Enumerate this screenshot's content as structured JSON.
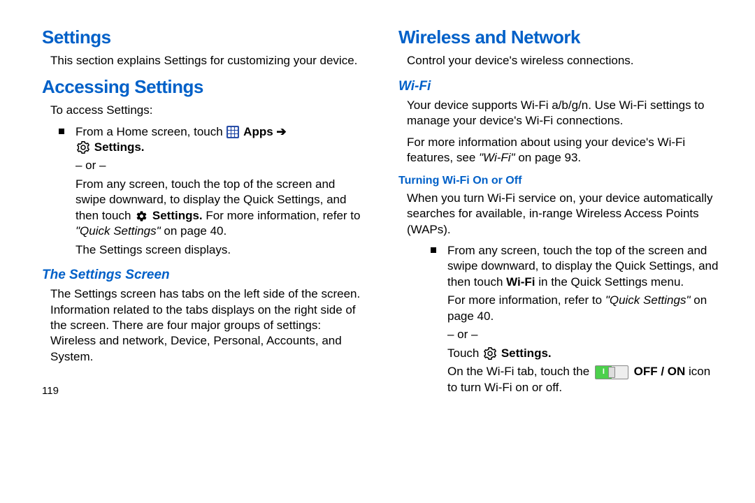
{
  "left": {
    "h_settings": "Settings",
    "p_intro": "This section explains Settings for customizing your device.",
    "h_accessing": "Accessing Settings",
    "p_toaccess": "To access Settings:",
    "b1_pre": "From a Home screen, touch",
    "b1_apps": "Apps",
    "b1_arrow": "➔",
    "b1_settings": "Settings.",
    "or": "– or –",
    "b1_alt1": "From any screen, touch the top of the screen and swipe downward, to display the Quick Settings, and then touch",
    "b1_alt_settings": "Settings.",
    "b1_alt2": " For more information, refer to ",
    "b1_alt_ref": "\"Quick Settings\"",
    "b1_alt_page": " on page 40.",
    "p_displays": "The Settings screen displays.",
    "h_screen": "The Settings Screen",
    "p_screen": "The Settings screen has tabs on the left side of the screen. Information related to the tabs displays on the right side of the screen. There are four major groups of settings: Wireless and network, Device, Personal, Accounts, and System.",
    "pagenum": "119"
  },
  "right": {
    "h_wireless": "Wireless and Network",
    "p_control": "Control your device's wireless connections.",
    "h_wifi": "Wi-Fi",
    "p_wifi1": "Your device supports Wi-Fi a/b/g/n. Use Wi-Fi settings to manage your device's Wi-Fi connections.",
    "p_wifi2a": "For more information about using your device's Wi-Fi features, see ",
    "p_wifi2_ref": "\"Wi-Fi\"",
    "p_wifi2b": " on page 93.",
    "h_turning": "Turning Wi-Fi On or Off",
    "p_turning": "When you turn Wi-Fi service on, your device automatically searches for available, in-range Wireless Access Points (WAPs).",
    "b_top1": "From any screen, touch the top of the screen and swipe downward, to display the Quick Settings, and then touch ",
    "b_top_wifi": "Wi-Fi",
    "b_top2": " in the Quick Settings menu.",
    "p_more1": "For more information, refer to ",
    "p_more_ref": "\"Quick Settings\"",
    "p_more2": " on page 40.",
    "or": "– or –",
    "p_touch": "Touch",
    "p_touch_settings": "Settings.",
    "p_on1": "On the Wi-Fi tab, touch the ",
    "p_on_offon": "OFF / ON",
    "p_on2": " icon to turn Wi-Fi on or off."
  }
}
